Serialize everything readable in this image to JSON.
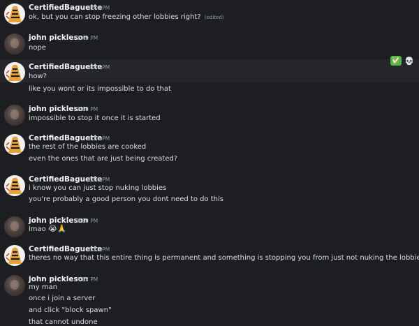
{
  "users": {
    "cb": "CertifiedBaguette",
    "jp": "john pickleson"
  },
  "messages": [
    {
      "author": "CertifiedBaguette",
      "time": "2:44 PM",
      "lines": [
        "ok, but you can stop freezing other lobbies right?"
      ],
      "edited": "(edited)"
    },
    {
      "author": "john pickleson",
      "time": "2:49 PM",
      "lines": [
        "nope"
      ]
    },
    {
      "author": "CertifiedBaguette",
      "time": "2:49 PM",
      "lines": [
        "how?",
        "like you wont or its impossible to do that"
      ]
    },
    {
      "author": "john pickleson",
      "time": "2:50 PM",
      "lines": [
        "impossible to stop it once it is started"
      ]
    },
    {
      "author": "CertifiedBaguette",
      "time": "2:51 PM",
      "lines": [
        "the rest of the lobbies are cooked",
        "even the ones that are just being created?"
      ]
    },
    {
      "author": "CertifiedBaguette",
      "time": "3:06 PM",
      "lines": [
        "i know you can just stop nuking lobbies",
        "you're probably a good person you dont need to do this"
      ]
    },
    {
      "author": "john pickleson",
      "time": "3:10 PM",
      "lines": [
        "lmao"
      ],
      "emojis": "😭🙏"
    },
    {
      "author": "CertifiedBaguette",
      "time": "3:13 PM",
      "lines": [
        "theres no way that this entire thing is permanent and something is stopping you from just not nuking the lobbies"
      ]
    },
    {
      "author": "john pickleson",
      "time": "4:32 PM",
      "lines": [
        "my man",
        "once i join a server",
        "and click \"block spawn\"",
        "that cannot undone"
      ]
    }
  ],
  "hover_reactions": {
    "check": "✅",
    "skull": "💀"
  }
}
